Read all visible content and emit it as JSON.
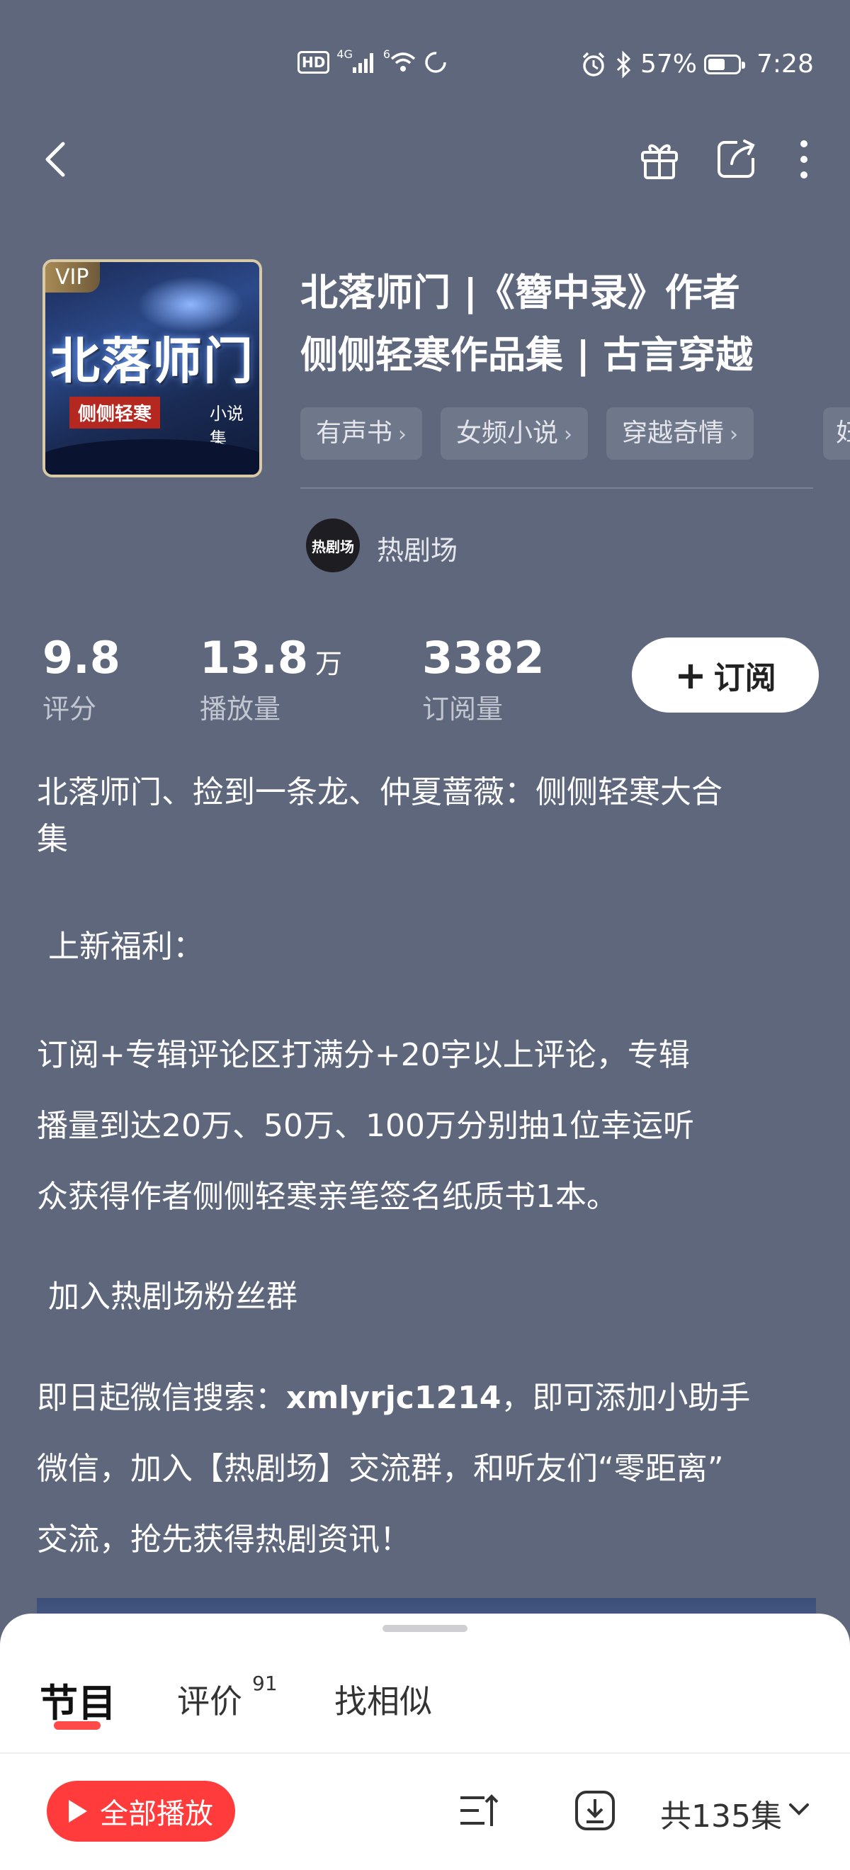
{
  "status_bar": {
    "left_badges": [
      "HD",
      "4G",
      "6"
    ],
    "battery_percent": "57%",
    "battery_level": 0.57,
    "time": "7:28"
  },
  "nav": {
    "back_icon": "back-arrow-icon",
    "right_icons": [
      "gift-icon",
      "share-icon",
      "more-icon"
    ]
  },
  "album": {
    "cover": {
      "vip_label": "VIP",
      "cover_title": "北落师门",
      "cover_subtitle": "侧侧轻寒",
      "cover_subtitle2": "小说集"
    },
    "title_line1": "北落师门 |《簪中录》作者",
    "title_line2": "侧侧轻寒作品集 | 古言穿越",
    "tags": [
      "有声书",
      "女频小说",
      "穿越奇情",
      "妇"
    ],
    "author": {
      "avatar_text": "热剧场",
      "name": "热剧场"
    }
  },
  "stats": {
    "rating_value": "9.8",
    "rating_label": "评分",
    "plays_value": "13.8",
    "plays_unit": "万",
    "plays_label": "播放量",
    "subs_value": "3382",
    "subs_label": "订阅量",
    "subscribe_button": "订阅"
  },
  "description": {
    "para1_line1": "北落师门、捡到一条龙、仲夏蔷薇：侧侧轻寒大合",
    "para1_line2": "集",
    "heading1": "上新福利：",
    "para2_line1": "订阅+专辑评论区打满分+20字以上评论，专辑",
    "para2_line2": "播量到达20万、50万、100万分别抽1位幸运听",
    "para2_line3": "众获得作者侧侧轻寒亲笔签名纸质书1本。",
    "heading2": "加入热剧场粉丝群",
    "para3_prefix": "即日起微信搜索：",
    "para3_wechat": "xmlyrjc1214",
    "para3_suffix": "，即可添加小助手",
    "para3_line2": "微信，加入【热剧场】交流群，和听友们“零距离”",
    "para3_line3": "交流，抢先获得热剧资讯！"
  },
  "bottom_sheet": {
    "tabs": [
      {
        "label": "节目",
        "active": true
      },
      {
        "label": "评价",
        "badge": "91"
      },
      {
        "label": "找相似"
      }
    ],
    "play_all": "全部播放",
    "total_episodes": "共135集",
    "accent_color": "#ff3b3b"
  }
}
